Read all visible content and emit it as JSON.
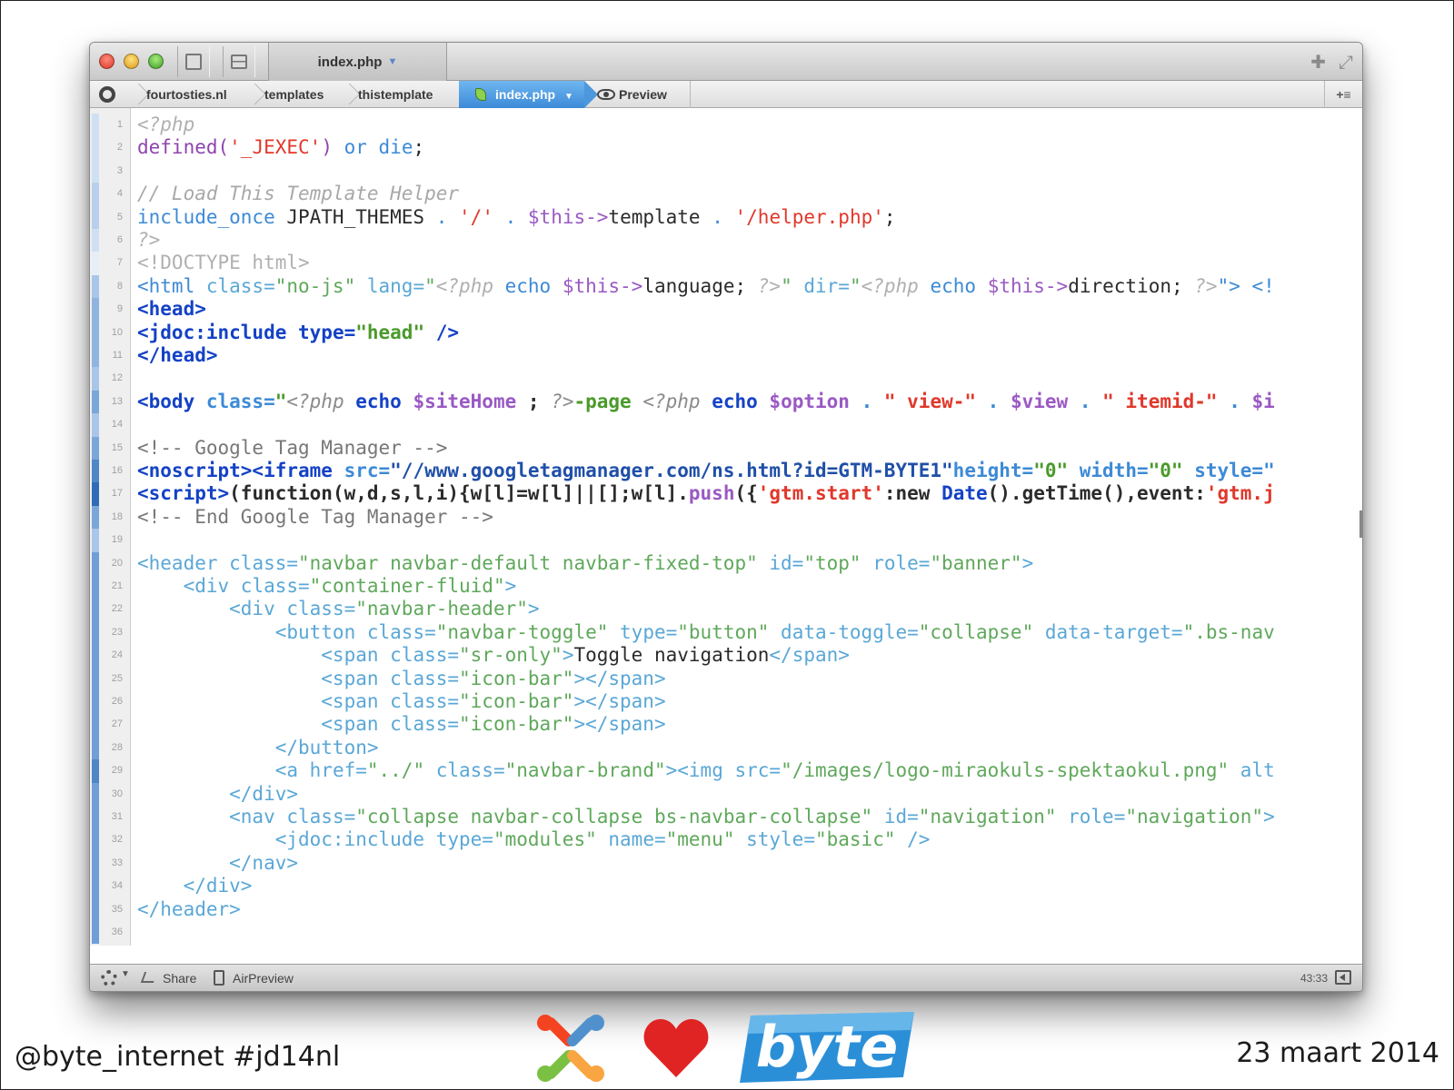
{
  "editor": {
    "window_title": "index.php",
    "breadcrumbs": [
      "fourtosties.nl",
      "templates",
      "thistemplate"
    ],
    "active_file": "index.php",
    "preview_label": "Preview",
    "toolbar_right_glyph": "+≡",
    "status": {
      "share_label": "Share",
      "airpreview_label": "AirPreview",
      "cursor_position": "43:33"
    },
    "colors": {
      "comment": "#9c9c9c",
      "keyword": "#3d8ad6",
      "string": "#e0382b",
      "variable": "#9a59c4",
      "plain": "#2b2b2b",
      "tag_bold": "#1442c6",
      "attr_value_green": "#4a9a2b",
      "faded_tag": "#5aa7d6",
      "faded_string": "#5fa85b",
      "gutter_bar": "#4e86c6"
    },
    "lines": [
      [
        {
          "t": "<?php",
          "c": "#b0b0b0",
          "i": true
        }
      ],
      [
        {
          "t": "defined(",
          "c": "#8e44ad"
        },
        {
          "t": "'_JEXEC'",
          "c": "#e0382b"
        },
        {
          "t": ") ",
          "c": "#8e44ad"
        },
        {
          "t": "or die",
          "c": "#3d8ad6"
        },
        {
          "t": ";",
          "c": "#2b2b2b"
        }
      ],
      [],
      [
        {
          "t": "// Load This Template Helper",
          "c": "#a8a8a8",
          "i": true
        }
      ],
      [
        {
          "t": "include_once",
          "c": "#3d8ad6"
        },
        {
          "t": " JPATH_THEMES ",
          "c": "#2b2b2b"
        },
        {
          "t": ". ",
          "c": "#3d8ad6"
        },
        {
          "t": "'/'",
          "c": "#e0382b"
        },
        {
          "t": " . ",
          "c": "#3d8ad6"
        },
        {
          "t": "$this->",
          "c": "#9a59c4"
        },
        {
          "t": "template ",
          "c": "#2b2b2b"
        },
        {
          "t": ". ",
          "c": "#3d8ad6"
        },
        {
          "t": "'/helper.php'",
          "c": "#e0382b"
        },
        {
          "t": ";",
          "c": "#2b2b2b"
        }
      ],
      [
        {
          "t": "?>",
          "c": "#b0b0b0",
          "i": true
        }
      ],
      [
        {
          "t": "<!DOCTYPE html>",
          "c": "#b0b0b0"
        }
      ],
      [
        {
          "t": "<html ",
          "c": "#3d8ad6"
        },
        {
          "t": "class=",
          "c": "#5aa7d6"
        },
        {
          "t": "\"no-js\"",
          "c": "#5fa85b"
        },
        {
          "t": " lang=",
          "c": "#5aa7d6"
        },
        {
          "t": "\"",
          "c": "#5fa85b"
        },
        {
          "t": "<?php",
          "c": "#b0b0b0",
          "i": true
        },
        {
          "t": " echo ",
          "c": "#3d8ad6"
        },
        {
          "t": "$this->",
          "c": "#9a59c4"
        },
        {
          "t": "language; ",
          "c": "#2b2b2b"
        },
        {
          "t": "?>",
          "c": "#b0b0b0",
          "i": true
        },
        {
          "t": "\" ",
          "c": "#5fa85b"
        },
        {
          "t": "dir=",
          "c": "#5aa7d6"
        },
        {
          "t": "\"",
          "c": "#5fa85b"
        },
        {
          "t": "<?php",
          "c": "#b0b0b0",
          "i": true
        },
        {
          "t": " echo ",
          "c": "#3d8ad6"
        },
        {
          "t": "$this->",
          "c": "#9a59c4"
        },
        {
          "t": "direction; ",
          "c": "#2b2b2b"
        },
        {
          "t": "?>",
          "c": "#b0b0b0",
          "i": true
        },
        {
          "t": "\"> <!",
          "c": "#3d8ad6"
        }
      ],
      [
        {
          "t": "<head>",
          "c": "#1442c6",
          "b": true
        }
      ],
      [
        {
          "t": "<jdoc:include ",
          "c": "#1442c6",
          "b": true
        },
        {
          "t": "type=",
          "c": "#1442c6",
          "b": true
        },
        {
          "t": "\"head\"",
          "c": "#4a9a2b",
          "b": true
        },
        {
          "t": " />",
          "c": "#1442c6",
          "b": true
        }
      ],
      [
        {
          "t": "</head>",
          "c": "#1442c6",
          "b": true
        }
      ],
      [],
      [
        {
          "t": "<body ",
          "c": "#1442c6",
          "b": true
        },
        {
          "t": "class=",
          "c": "#3d8ad6",
          "b": true
        },
        {
          "t": "\"",
          "c": "#4a9a2b",
          "b": true
        },
        {
          "t": "<?php",
          "c": "#8a8a8a",
          "i": true
        },
        {
          "t": " echo ",
          "c": "#1442c6",
          "b": true
        },
        {
          "t": "$siteHome",
          "c": "#9a59c4",
          "b": true
        },
        {
          "t": " ; ",
          "c": "#2b2b2b",
          "b": true
        },
        {
          "t": "?>",
          "c": "#8a8a8a",
          "i": true
        },
        {
          "t": "-page ",
          "c": "#4a9a2b",
          "b": true
        },
        {
          "t": "<?php",
          "c": "#8a8a8a",
          "i": true
        },
        {
          "t": " echo ",
          "c": "#1442c6",
          "b": true
        },
        {
          "t": "$option",
          "c": "#9a59c4",
          "b": true
        },
        {
          "t": " . ",
          "c": "#3d8ad6",
          "b": true
        },
        {
          "t": "\" view-\"",
          "c": "#e0382b",
          "b": true
        },
        {
          "t": " . ",
          "c": "#3d8ad6",
          "b": true
        },
        {
          "t": "$view",
          "c": "#9a59c4",
          "b": true
        },
        {
          "t": " . ",
          "c": "#3d8ad6",
          "b": true
        },
        {
          "t": "\" itemid-\"",
          "c": "#e0382b",
          "b": true
        },
        {
          "t": " . ",
          "c": "#3d8ad6",
          "b": true
        },
        {
          "t": "$i",
          "c": "#9a59c4",
          "b": true
        }
      ],
      [],
      [
        {
          "t": "<!-- Google Tag Manager -->",
          "c": "#777777"
        }
      ],
      [
        {
          "t": "<noscript><iframe ",
          "c": "#1442c6",
          "b": true
        },
        {
          "t": "src=",
          "c": "#3d8ad6",
          "b": true
        },
        {
          "t": "\"//www.googletagmanager.com/ns.html?id=GTM-BYTE1\"",
          "c": "#1f4fa8",
          "b": true
        },
        {
          "t": "height=",
          "c": "#3d8ad6",
          "b": true
        },
        {
          "t": "\"0\"",
          "c": "#4a9a2b",
          "b": true
        },
        {
          "t": " width=",
          "c": "#3d8ad6",
          "b": true
        },
        {
          "t": "\"0\"",
          "c": "#4a9a2b",
          "b": true
        },
        {
          "t": " style=\"",
          "c": "#3d8ad6",
          "b": true
        }
      ],
      [
        {
          "t": "<script>",
          "c": "#1442c6",
          "b": true
        },
        {
          "t": "(function(w,d,s,l,i){w[l]=w[l]||[];w[l].",
          "c": "#2b2b2b",
          "b": true
        },
        {
          "t": "push",
          "c": "#9a59c4",
          "b": true
        },
        {
          "t": "({",
          "c": "#2b2b2b",
          "b": true
        },
        {
          "t": "'gtm.start'",
          "c": "#e0382b",
          "b": true
        },
        {
          "t": ":new ",
          "c": "#2b2b2b",
          "b": true
        },
        {
          "t": "Date",
          "c": "#1442c6",
          "b": true
        },
        {
          "t": "().getTime(),event:",
          "c": "#2b2b2b",
          "b": true
        },
        {
          "t": "'gtm.j",
          "c": "#e0382b",
          "b": true
        }
      ],
      [
        {
          "t": "<!-- End Google Tag Manager -->",
          "c": "#777777"
        }
      ],
      [],
      [
        {
          "t": "<header ",
          "c": "#5aa7d6"
        },
        {
          "t": "class=",
          "c": "#5aa7d6"
        },
        {
          "t": "\"navbar navbar-default navbar-fixed-top\"",
          "c": "#5fa85b"
        },
        {
          "t": " id=",
          "c": "#5aa7d6"
        },
        {
          "t": "\"top\"",
          "c": "#5fa85b"
        },
        {
          "t": " role=",
          "c": "#5aa7d6"
        },
        {
          "t": "\"banner\"",
          "c": "#5fa85b"
        },
        {
          "t": ">",
          "c": "#5aa7d6"
        }
      ],
      [
        {
          "t": "    <div ",
          "c": "#5aa7d6"
        },
        {
          "t": "class=",
          "c": "#5aa7d6"
        },
        {
          "t": "\"container-fluid\"",
          "c": "#5fa85b"
        },
        {
          "t": ">",
          "c": "#5aa7d6"
        }
      ],
      [
        {
          "t": "        <div ",
          "c": "#5aa7d6"
        },
        {
          "t": "class=",
          "c": "#5aa7d6"
        },
        {
          "t": "\"navbar-header\"",
          "c": "#5fa85b"
        },
        {
          "t": ">",
          "c": "#5aa7d6"
        }
      ],
      [
        {
          "t": "            <button ",
          "c": "#5aa7d6"
        },
        {
          "t": "class=",
          "c": "#5aa7d6"
        },
        {
          "t": "\"navbar-toggle\"",
          "c": "#5fa85b"
        },
        {
          "t": " type=",
          "c": "#5aa7d6"
        },
        {
          "t": "\"button\"",
          "c": "#5fa85b"
        },
        {
          "t": " data-toggle=",
          "c": "#5aa7d6"
        },
        {
          "t": "\"collapse\"",
          "c": "#5fa85b"
        },
        {
          "t": " data-target=",
          "c": "#5aa7d6"
        },
        {
          "t": "\".bs-nav",
          "c": "#5fa85b"
        }
      ],
      [
        {
          "t": "                <span ",
          "c": "#5aa7d6"
        },
        {
          "t": "class=",
          "c": "#5aa7d6"
        },
        {
          "t": "\"sr-only\"",
          "c": "#5fa85b"
        },
        {
          "t": ">",
          "c": "#5aa7d6"
        },
        {
          "t": "Toggle navigation",
          "c": "#2b2b2b"
        },
        {
          "t": "</span>",
          "c": "#5aa7d6"
        }
      ],
      [
        {
          "t": "                <span ",
          "c": "#5aa7d6"
        },
        {
          "t": "class=",
          "c": "#5aa7d6"
        },
        {
          "t": "\"icon-bar\"",
          "c": "#5fa85b"
        },
        {
          "t": "></span>",
          "c": "#5aa7d6"
        }
      ],
      [
        {
          "t": "                <span ",
          "c": "#5aa7d6"
        },
        {
          "t": "class=",
          "c": "#5aa7d6"
        },
        {
          "t": "\"icon-bar\"",
          "c": "#5fa85b"
        },
        {
          "t": "></span>",
          "c": "#5aa7d6"
        }
      ],
      [
        {
          "t": "                <span ",
          "c": "#5aa7d6"
        },
        {
          "t": "class=",
          "c": "#5aa7d6"
        },
        {
          "t": "\"icon-bar\"",
          "c": "#5fa85b"
        },
        {
          "t": "></span>",
          "c": "#5aa7d6"
        }
      ],
      [
        {
          "t": "            </button>",
          "c": "#5aa7d6"
        }
      ],
      [
        {
          "t": "            <a ",
          "c": "#5aa7d6"
        },
        {
          "t": "href=",
          "c": "#5aa7d6"
        },
        {
          "t": "\"../\"",
          "c": "#5fa85b"
        },
        {
          "t": " class=",
          "c": "#5aa7d6"
        },
        {
          "t": "\"navbar-brand\"",
          "c": "#5fa85b"
        },
        {
          "t": "><img ",
          "c": "#5aa7d6"
        },
        {
          "t": "src=",
          "c": "#5aa7d6"
        },
        {
          "t": "\"/images/logo-miraokuls-spektaokul.png\"",
          "c": "#5fa85b"
        },
        {
          "t": " alt",
          "c": "#5aa7d6"
        }
      ],
      [
        {
          "t": "        </div>",
          "c": "#5aa7d6"
        }
      ],
      [
        {
          "t": "        <nav ",
          "c": "#5aa7d6"
        },
        {
          "t": "class=",
          "c": "#5aa7d6"
        },
        {
          "t": "\"collapse navbar-collapse bs-navbar-collapse\"",
          "c": "#5fa85b"
        },
        {
          "t": " id=",
          "c": "#5aa7d6"
        },
        {
          "t": "\"navigation\"",
          "c": "#5fa85b"
        },
        {
          "t": " role=",
          "c": "#5aa7d6"
        },
        {
          "t": "\"navigation\"",
          "c": "#5fa85b"
        },
        {
          "t": ">",
          "c": "#5aa7d6"
        }
      ],
      [
        {
          "t": "            <jdoc:include ",
          "c": "#5aa7d6"
        },
        {
          "t": "type=",
          "c": "#5aa7d6"
        },
        {
          "t": "\"modules\"",
          "c": "#5fa85b"
        },
        {
          "t": " name=",
          "c": "#5aa7d6"
        },
        {
          "t": "\"menu\"",
          "c": "#5fa85b"
        },
        {
          "t": " style=",
          "c": "#5aa7d6"
        },
        {
          "t": "\"basic\"",
          "c": "#5fa85b"
        },
        {
          "t": " />",
          "c": "#5aa7d6"
        }
      ],
      [
        {
          "t": "        </nav>",
          "c": "#5aa7d6"
        }
      ],
      [
        {
          "t": "    </div>",
          "c": "#5aa7d6"
        }
      ],
      [
        {
          "t": "</header>",
          "c": "#5aa7d6"
        }
      ],
      []
    ],
    "gutter_shades": [
      "#cfe0f2",
      "#cfe0f2",
      "#cfe0f2",
      "#b8d0ec",
      "#b8d0ec",
      "#cfe0f2",
      "#e6eef8",
      "#a9c6e8",
      "#8fb4e0",
      "#8fb4e0",
      "#8fb4e0",
      "#a9c6e8",
      "#7aa6da",
      "#a9c6e8",
      "#7aa6da",
      "#4e86c6",
      "#2f6cb8",
      "#7aa6da",
      "#a9c6e8",
      "#6f9fd6",
      "#6f9fd6",
      "#6f9fd6",
      "#6f9fd6",
      "#6f9fd6",
      "#6f9fd6",
      "#6f9fd6",
      "#6f9fd6",
      "#6f9fd6",
      "#4e86c6",
      "#6f9fd6",
      "#6f9fd6",
      "#6f9fd6",
      "#6f9fd6",
      "#6f9fd6",
      "#6f9fd6",
      "#6f9fd6"
    ]
  },
  "footer": {
    "left_text": "@byte_internet #jd14nl",
    "right_text": "23 maart 2014",
    "logo_byte_text": "byte"
  }
}
